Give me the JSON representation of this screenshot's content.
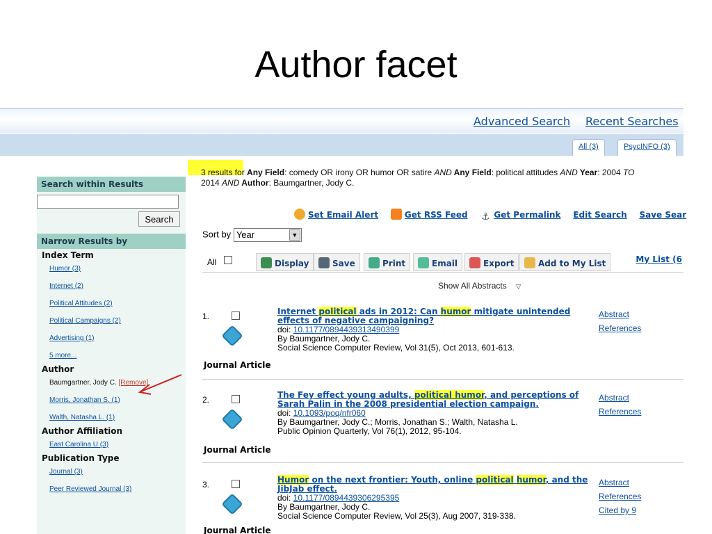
{
  "slide": {
    "title": "Author facet"
  },
  "topbar": {
    "advanced_search": "Advanced Search",
    "recent_searches": "Recent Searches"
  },
  "tabs": [
    {
      "label": "All (3)"
    },
    {
      "label": "PsycINFO (3)"
    }
  ],
  "sidebar": {
    "search_within": "Search within Results",
    "search_button": "Search",
    "narrow_header": "Narrow Results by",
    "index_term": {
      "header": "Index Term",
      "items": [
        "Humor (3)",
        "Internet (2)",
        "Political Attitudes (2)",
        "Political Campaigns (2)",
        "Advertising (1)",
        "5 more..."
      ]
    },
    "author": {
      "header": "Author",
      "selected": "Baumgartner, Jody C.",
      "remove": "[Remove]",
      "items": [
        "Morris, Jonathan S. (1)",
        "Walth, Natasha L. (1)"
      ]
    },
    "affiliation": {
      "header": "Author Affiliation",
      "items": [
        "East Carolina U (3)"
      ]
    },
    "pubtype": {
      "header": "Publication Type",
      "items": [
        "Journal (3)",
        "Peer Reviewed Journal (3)"
      ]
    }
  },
  "results_summary": {
    "count": "3 results for",
    "field1": "Any Field",
    "query1": ": comedy OR irony OR humor OR satire ",
    "and1": "AND",
    "field2": " Any Field",
    "query2": ": political attitudes ",
    "and2": "AND",
    "field3": " Year",
    "query3": ": 2004 ",
    "to": "TO",
    "line2_a": "2014 ",
    "and3": "AND",
    "field4": " Author",
    "query4": ": Baumgartner, Jody C."
  },
  "actions": {
    "email_alert": "Set Email Alert",
    "rss": "Get RSS Feed",
    "permalink": "Get Permalink",
    "edit": "Edit Search",
    "save": "Save Sear"
  },
  "sort": {
    "label": "Sort by",
    "value": "Year"
  },
  "toolbar": {
    "all": "All",
    "display": "Display",
    "save": "Save",
    "print": "Print",
    "email": "Email",
    "export": "Export",
    "add": "Add to My List",
    "mylist": "My List (6"
  },
  "show_abstracts": "Show All Abstracts",
  "results": [
    {
      "num": "1.",
      "title_parts": [
        "Internet ",
        "political",
        " ads in 2012: Can ",
        "humor",
        " mitigate unintended effects of negative campaigning?"
      ],
      "doi_label": "doi: ",
      "doi": "10.1177/0894439313490399",
      "by": "By Baumgartner, Jody C.",
      "source": "Social Science Computer Review, Vol 31(5), Oct 2013, 601-613.",
      "type": "Journal Article",
      "links": [
        "Abstract",
        "References"
      ]
    },
    {
      "num": "2.",
      "title_parts": [
        "The Fey effect young adults, ",
        "political humor",
        ", and perceptions of Sarah Palin in the 2008 presidential election campaign."
      ],
      "doi_label": "doi: ",
      "doi": "10.1093/poq/nfr060",
      "by": "By Baumgartner, Jody C.; Morris, Jonathan S.; Walth, Natasha L.",
      "source": "Public Opinion Quarterly, Vol 76(1), 2012, 95-104.",
      "type": "Journal Article",
      "links": [
        "Abstract",
        "References"
      ]
    },
    {
      "num": "3.",
      "title_parts": [
        "Humor",
        " on the next frontier: Youth, online ",
        "political",
        " ",
        "humor",
        ", and the JibJab effect."
      ],
      "doi_label": "doi: ",
      "doi": "10.1177/0894439306295395",
      "by": "By Baumgartner, Jody C.",
      "source": "Social Science Computer Review, Vol 25(3), Aug 2007, 319-338.",
      "type": "Journal Article",
      "links": [
        "Abstract",
        "References",
        "Cited by 9"
      ]
    }
  ],
  "colors": {
    "link": "#0b4f9e",
    "highlight": "#ffff33",
    "sidebar_header": "#9fd0c4",
    "arrow": "#cc2222"
  }
}
